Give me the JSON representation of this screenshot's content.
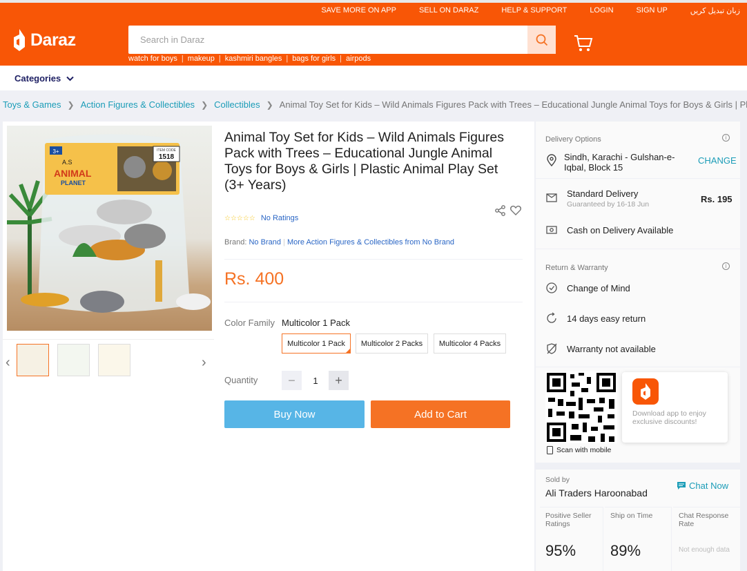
{
  "header": {
    "top_links": [
      "SAVE MORE ON APP",
      "SELL ON DARAZ",
      "HELP & SUPPORT",
      "LOGIN",
      "SIGN UP",
      "زبان تبدیل کریں"
    ],
    "logo_text": "Daraz",
    "search_placeholder": "Search in Daraz",
    "suggestions": [
      "watch for boys",
      "makeup",
      "kashmiri bangles",
      "bags for girls",
      "airpods"
    ],
    "categories_label": "Categories",
    "brand_color": "#f85606"
  },
  "breadcrumb": {
    "items": [
      "Toys & Games",
      "Action Figures & Collectibles",
      "Collectibles"
    ],
    "current": "Animal Toy Set for Kids – Wild Animals Figures Pack with Trees – Educational Jungle Animal Toys for Boys & Girls | Plastic"
  },
  "product": {
    "title": "Animal Toy Set for Kids – Wild Animals Figures Pack with Trees – Educational Jungle Animal Toys for Boys & Girls | Plastic Animal Play Set (3+ Years)",
    "ratings_text": "No Ratings",
    "brand_label": "Brand:",
    "brand_name": "No Brand",
    "brand_more": "More Action Figures & Collectibles from No Brand",
    "price": "Rs. 400",
    "image_text": {
      "badge": "3+",
      "brand_line": "A.S",
      "product_name_1": "ANIMAL",
      "product_name_2": "PLANET",
      "item_code_label": "ITEM CODE",
      "item_code": "1518"
    },
    "color_family_label": "Color Family",
    "color_family_value": "Multicolor 1 Pack",
    "options": [
      "Multicolor 1 Pack",
      "Multicolor 2 Packs",
      "Multicolor 4 Packs"
    ],
    "quantity_label": "Quantity",
    "quantity": "1",
    "buy_now": "Buy Now",
    "add_to_cart": "Add to Cart"
  },
  "delivery": {
    "title": "Delivery Options",
    "location": "Sindh, Karachi - Gulshan-e-Iqbal, Block 15",
    "change": "CHANGE",
    "standard": "Standard Delivery",
    "guaranteed": "Guaranteed by 16-18 Jun",
    "fee": "Rs. 195",
    "cod": "Cash on Delivery Available",
    "return_title": "Return & Warranty",
    "change_of_mind": "Change of Mind",
    "easy_return": "14 days easy return",
    "warranty": "Warranty not available",
    "app_text": "Download app to enjoy exclusive discounts!",
    "scan": "Scan with mobile"
  },
  "seller": {
    "sold_by": "Sold by",
    "name": "Ali Traders Haroonabad",
    "chat": "Chat Now",
    "stats": [
      {
        "label": "Positive Seller Ratings",
        "value": "95%"
      },
      {
        "label": "Ship on Time",
        "value": "89%"
      },
      {
        "label": "Chat Response Rate",
        "value": "Not enough data"
      }
    ]
  }
}
